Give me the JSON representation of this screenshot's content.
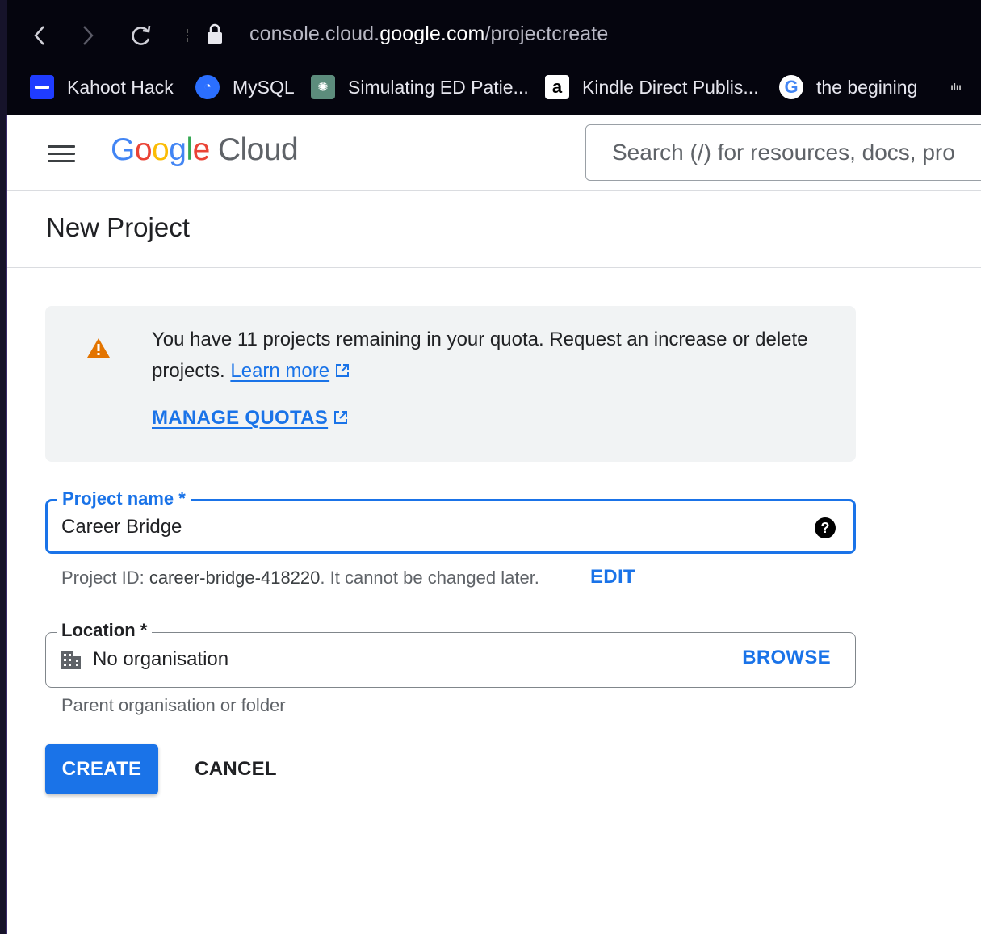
{
  "browser": {
    "url_host_prefix": "console.cloud.",
    "url_host": "google.com",
    "url_path": "/projectcreate",
    "bookmarks": [
      {
        "label": "Kahoot Hack",
        "icon": "kahoot-icon",
        "color": "#1f3cff"
      },
      {
        "label": "MySQL",
        "icon": "mysql-icon",
        "color": "#2b6fff"
      },
      {
        "label": "Simulating ED Patie...",
        "icon": "chatgpt-icon",
        "color": "#5c8c7c"
      },
      {
        "label": "Kindle Direct Publis...",
        "icon": "amazon-icon",
        "color": "#ff9900"
      },
      {
        "label": "the begining",
        "icon": "google-icon",
        "color": "#4285f4"
      },
      {
        "label": "",
        "icon": "cisco-icon",
        "color": "#cccccc"
      }
    ]
  },
  "header": {
    "logo_letters": [
      "G",
      "o",
      "o",
      "g",
      "l",
      "e"
    ],
    "logo_product": "Cloud",
    "search_placeholder": "Search (/) for resources, docs, pro"
  },
  "page": {
    "title": "New Project"
  },
  "quota_banner": {
    "message": "You have 11 projects remaining in your quota. Request an increase or delete projects.",
    "learn_more": "Learn more",
    "manage_quotas": "MANAGE QUOTAS",
    "warning_color": "#e37400"
  },
  "form": {
    "project_name_label": "Project name *",
    "project_name_value": "Career Bridge",
    "project_id_prefix": "Project ID: ",
    "project_id": "career-bridge-418220",
    "project_id_suffix": ". It cannot be changed later.",
    "edit_label": "EDIT",
    "location_label": "Location *",
    "location_value": "No organisation",
    "browse_label": "BROWSE",
    "location_hint": "Parent organisation or folder"
  },
  "actions": {
    "create": "CREATE",
    "cancel": "CANCEL"
  },
  "colors": {
    "primary": "#1a73e8",
    "chrome_bg": "#05050e",
    "banner_bg": "#f1f3f4"
  }
}
